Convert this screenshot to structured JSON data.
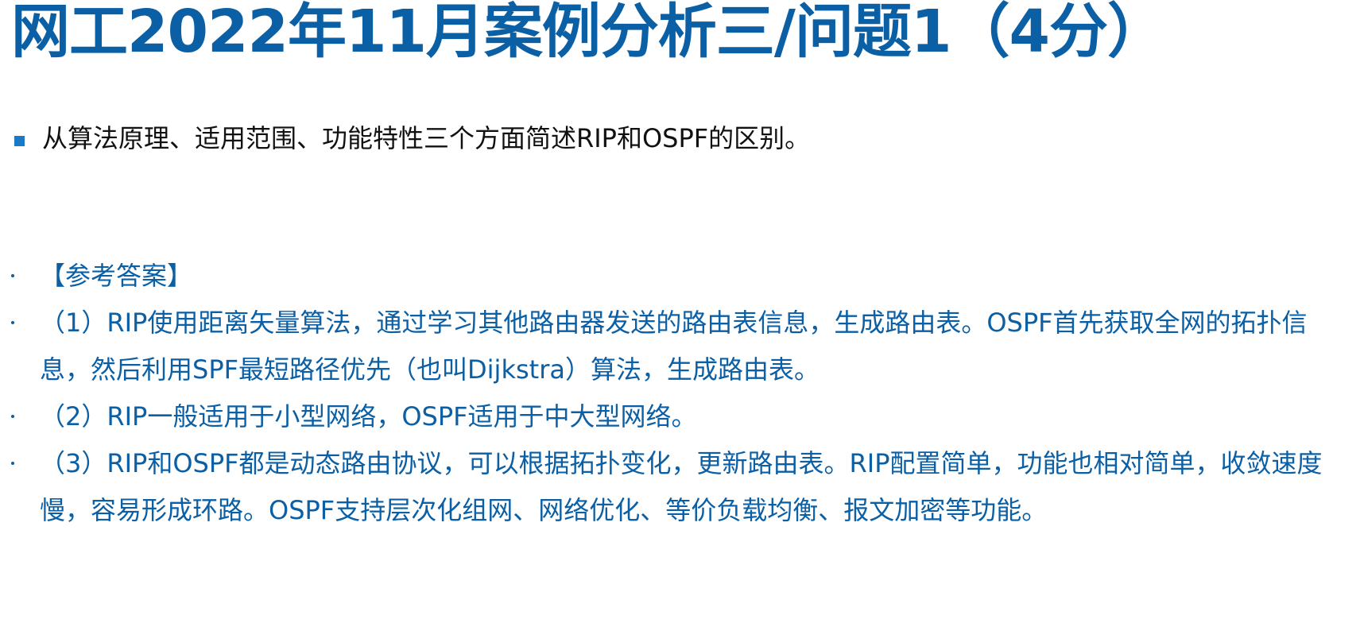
{
  "slide": {
    "title": "网工2022年11月案例分析三/问题1（4分）",
    "question": "从算法原理、适用范围、功能特性三个方面简述RIP和OSPF的区别。",
    "answers": [
      "【参考答案】",
      "（1）RIP使用距离矢量算法，通过学习其他路由器发送的路由表信息，生成路由表。OSPF首先获取全网的拓扑信息，然后利用SPF最短路径优先（也叫Dijkstra）算法，生成路由表。",
      "（2）RIP一般适用于小型网络，OSPF适用于中大型网络。",
      "（3）RIP和OSPF都是动态路由协议，可以根据拓扑变化，更新路由表。RIP配置简单，功能也相对简单，收敛速度慢，容易形成环路。OSPF支持层次化组网、网络优化、等价负载均衡、报文加密等功能。"
    ]
  },
  "colors": {
    "title": "#0a5fa5",
    "answer_text": "#0a5fa5",
    "question_bullet": "#1b7ac8",
    "question_text": "#111111",
    "background": "#ffffff"
  }
}
